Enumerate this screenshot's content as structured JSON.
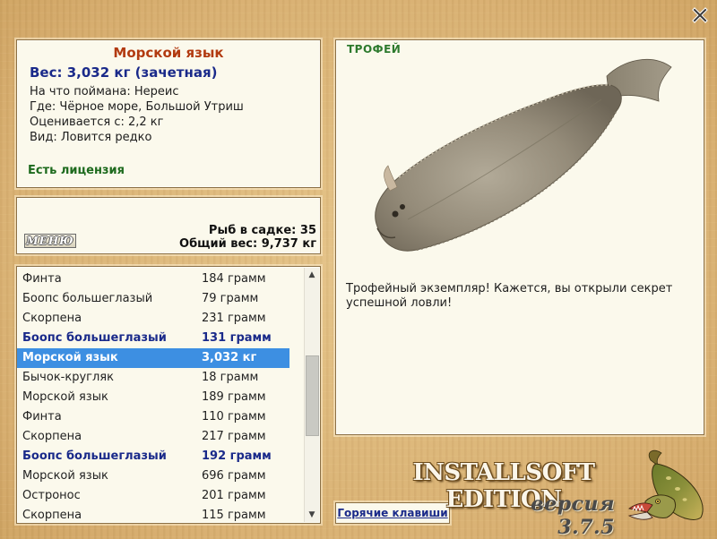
{
  "info": {
    "title": "Морской язык",
    "weight": "Вес: 3,032 кг (зачетная)",
    "lines": [
      "На что поймана: Нереис",
      "Где: Чёрное море, Большой Утриш",
      "Оценивается с: 2,2 кг",
      "Вид: Ловится редко"
    ],
    "license": "Есть лицензия"
  },
  "summary": {
    "menu_label": "МЕНЮ",
    "fish_in_keepnet": "Рыб в садке: 35",
    "total_weight": "Общий вес: 9,737 кг"
  },
  "catch_list": [
    {
      "name": "Финта",
      "weight": "184 грамм",
      "style": "normal"
    },
    {
      "name": "Боопс большеглазый",
      "weight": "79 грамм",
      "style": "normal"
    },
    {
      "name": "Скорпена",
      "weight": "231 грамм",
      "style": "normal"
    },
    {
      "name": "Боопс большеглазый",
      "weight": "131 грамм",
      "style": "highlight"
    },
    {
      "name": "Морской язык",
      "weight": "3,032 кг",
      "style": "selected"
    },
    {
      "name": "Бычок-кругляк",
      "weight": "18 грамм",
      "style": "normal"
    },
    {
      "name": "Морской язык",
      "weight": "189 грамм",
      "style": "normal"
    },
    {
      "name": "Финта",
      "weight": "110 грамм",
      "style": "normal"
    },
    {
      "name": "Скорпена",
      "weight": "217 грамм",
      "style": "normal"
    },
    {
      "name": "Боопс большеглазый",
      "weight": "192 грамм",
      "style": "highlight"
    },
    {
      "name": "Морской язык",
      "weight": "696 грамм",
      "style": "normal"
    },
    {
      "name": "Остронос",
      "weight": "201 грамм",
      "style": "normal"
    },
    {
      "name": "Скорпена",
      "weight": "115 грамм",
      "style": "normal"
    }
  ],
  "trophy": {
    "label": "ТРОФЕЙ",
    "text": "Трофейный экземпляр! Кажется, вы открыли секрет успешной ловли!"
  },
  "footer": {
    "hotkeys_label": "Горячие клавиши",
    "brand": "INSTALLSOFT EDITION",
    "version": "версия 3.7.5"
  },
  "icons": {
    "close": "close-icon",
    "scroll_up": "scroll-up-arrow-icon",
    "scroll_down": "scroll-down-arrow-icon",
    "logo": "pike-fish-logo"
  },
  "colors": {
    "background": "#dcb679",
    "panel": "#fbf9ec",
    "title": "#b23a10",
    "weight": "#1a2a8a",
    "license": "#1d6a1d",
    "selection": "#3d8fe2",
    "trophy_label": "#2d7a2d"
  }
}
